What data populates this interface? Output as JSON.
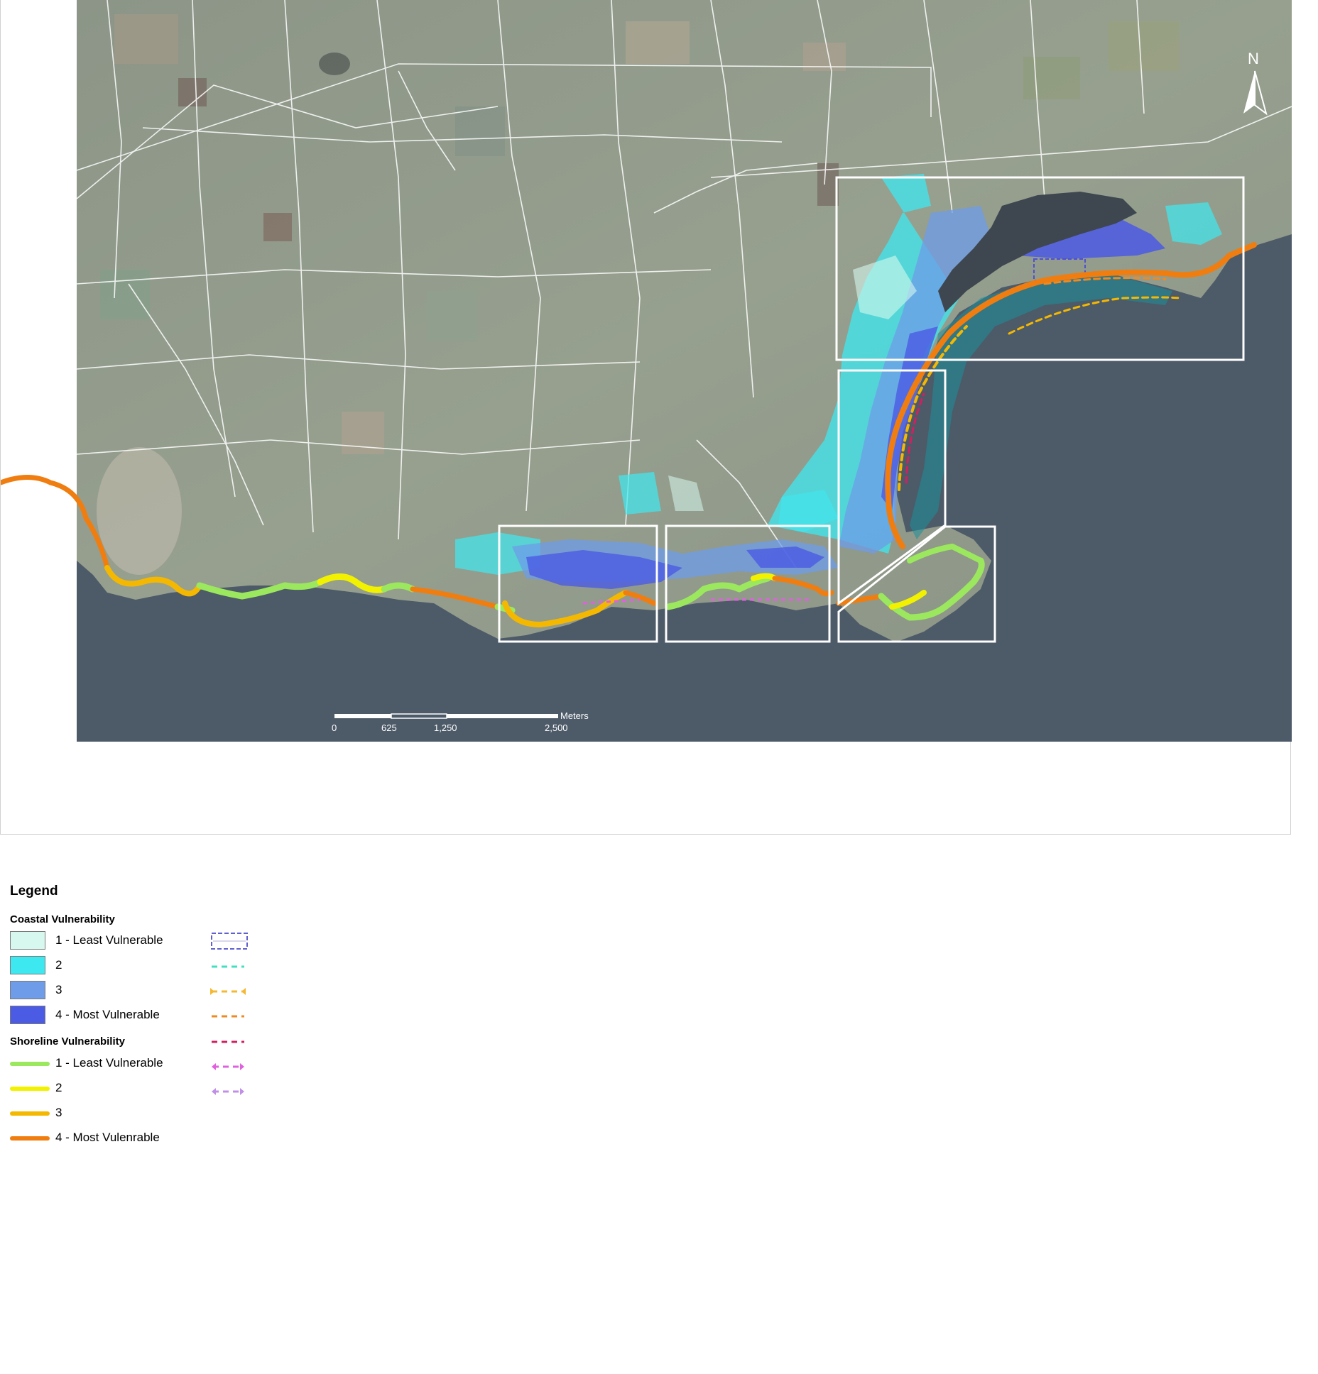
{
  "map": {
    "north_arrow_label": "N",
    "scale_bar": {
      "unit": "Meters",
      "ticks": [
        "0",
        "625",
        "1,250",
        "2,500"
      ]
    },
    "colors": {
      "ocean": "#4a5a6a",
      "land": "#8f9a8c",
      "coastal_1": "#cdf7ec",
      "coastal_2": "#3cebef",
      "coastal_3": "#6b9ae8",
      "coastal_4": "#4a5ae6",
      "shore_1": "#9be85e",
      "shore_2": "#f2f200",
      "shore_3": "#f5b800",
      "shore_4": "#f07d10"
    }
  },
  "legend": {
    "title": "Legend",
    "coastal_heading": "Coastal Vulnerability",
    "coastal_items": [
      {
        "label": "1 - Least Vulnerable",
        "color": "#d6f8ee"
      },
      {
        "label": "2",
        "color": "#3ee8f0"
      },
      {
        "label": "3",
        "color": "#6e9ce8"
      },
      {
        "label": "4 - Most Vulnerable",
        "color": "#4b5be4"
      }
    ],
    "shoreline_heading": "Shoreline Vulnerability",
    "shoreline_items": [
      {
        "label": "1 - Least Vulnerable",
        "color": "#9be85e"
      },
      {
        "label": "2",
        "color": "#f2f200"
      },
      {
        "label": "3",
        "color": "#f5b800"
      },
      {
        "label": "4 - Most Vulenrable",
        "color": "#f07d10"
      }
    ],
    "symbol_colors": [
      "#6060d0",
      "#40e0c0",
      "#f5b830",
      "#f08a20",
      "#d02060",
      "#e060e0",
      "#c090e8"
    ]
  }
}
